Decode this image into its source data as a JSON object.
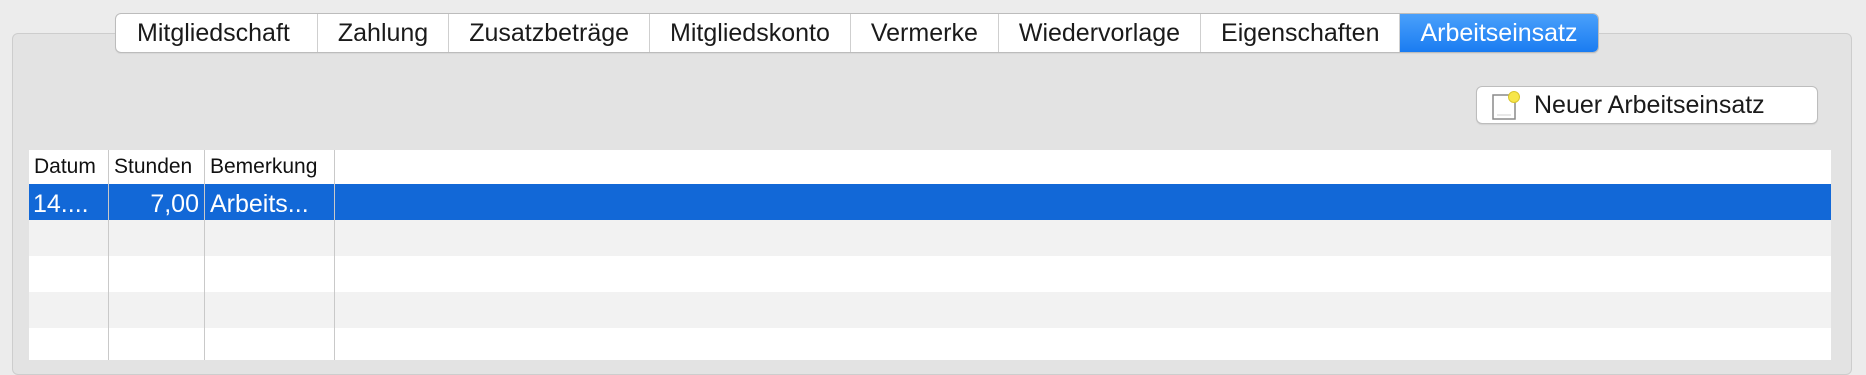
{
  "tabs": [
    {
      "label": "Mitgliedschaft",
      "active": false
    },
    {
      "label": "Zahlung",
      "active": false
    },
    {
      "label": "Zusatzbeträge",
      "active": false
    },
    {
      "label": "Mitgliedskonto",
      "active": false
    },
    {
      "label": "Vermerke",
      "active": false
    },
    {
      "label": "Wiedervorlage",
      "active": false
    },
    {
      "label": "Eigenschaften",
      "active": false
    },
    {
      "label": "Arbeitseinsatz",
      "active": true
    }
  ],
  "toolbar": {
    "new_button_label": "Neuer Arbeitseinsatz",
    "new_button_icon": "new-document-icon"
  },
  "table": {
    "columns": [
      "Datum",
      "Stunden",
      "Bemerkung"
    ],
    "rows": [
      {
        "datum": "14....",
        "stunden": "7,00",
        "bemerkung": "Arbeits...",
        "selected": true
      }
    ]
  },
  "colors": {
    "accent": "#1a7cf1",
    "selection": "#1268d7"
  }
}
